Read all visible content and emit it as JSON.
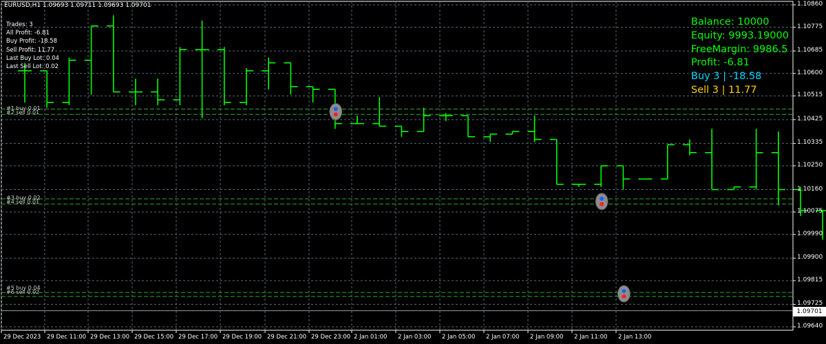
{
  "chart": {
    "symbol_header": "EURUSD,H1  1.09693 1.09711 1.09693 1.09701",
    "last_price": "1.09701"
  },
  "stats": {
    "trades": "Trades: 3",
    "all_profit": "All Profit: -6.81",
    "buy_profit": "Buy Profit: -18.58",
    "sell_profit": "Sell Profit: 11.77",
    "last_buy_lot": "Last Buy Lot: 0.04",
    "last_sell_lot": "Last Sell Lot: 0.02"
  },
  "account": {
    "balance": "Balance: 10000",
    "equity": "Equity: 9993.19000",
    "free_margin": "FreeMargin: 9986.5",
    "profit": "Profit: -6.81",
    "buy": "Buy 3 | -18.58",
    "sell": "Sell 3 | 11.77"
  },
  "order_labels": [
    {
      "buy": "#1 buy 0.01",
      "sell": "#2 sell 0.01"
    },
    {
      "buy": "#3 buy 0.02",
      "sell": "#4 sell 0.01"
    },
    {
      "buy": "#5 buy 0.04",
      "sell": "#6 sell 0.02"
    }
  ],
  "price_axis": [
    "1.10860",
    "1.10775",
    "1.10685",
    "1.10600",
    "1.10515",
    "1.10425",
    "1.10335",
    "1.10250",
    "1.10160",
    "1.10075",
    "1.09990",
    "1.09900",
    "1.09815",
    "1.09725",
    "1.09640"
  ],
  "time_axis": [
    "29 Dec 2023",
    "29 Dec 11:00",
    "29 Dec 13:00",
    "29 Dec 15:00",
    "29 Dec 17:00",
    "29 Dec 19:00",
    "29 Dec 21:00",
    "29 Dec 23:00",
    "2 Jan 01:00",
    "2 Jan 03:00",
    "2 Jan 05:00",
    "2 Jan 07:00",
    "2 Jan 09:00",
    "2 Jan 11:00",
    "2 Jan 13:00"
  ],
  "colors": {
    "bars": "#00ff00",
    "grid": "#5a6b7a",
    "order_line": "#2fa82f",
    "equity_text": "#00ff00",
    "buy_text": "#00d8ff",
    "sell_text": "#ffd000"
  },
  "chart_data": {
    "type": "ohlc",
    "ylim": [
      1.096,
      1.109
    ],
    "bars": [
      {
        "o": 1.1061,
        "h": 1.1064,
        "l": 1.1049,
        "c": 1.1061
      },
      {
        "o": 1.1061,
        "h": 1.1061,
        "l": 1.1047,
        "c": 1.1049
      },
      {
        "o": 1.1049,
        "h": 1.1066,
        "l": 1.1048,
        "c": 1.1065
      },
      {
        "o": 1.1065,
        "h": 1.1078,
        "l": 1.1052,
        "c": 1.1078
      },
      {
        "o": 1.1078,
        "h": 1.1082,
        "l": 1.1053,
        "c": 1.1053
      },
      {
        "o": 1.1053,
        "h": 1.1058,
        "l": 1.1048,
        "c": 1.1053
      },
      {
        "o": 1.1053,
        "h": 1.1058,
        "l": 1.1048,
        "c": 1.105
      },
      {
        "o": 1.105,
        "h": 1.107,
        "l": 1.1048,
        "c": 1.1069
      },
      {
        "o": 1.1069,
        "h": 1.108,
        "l": 1.1043,
        "c": 1.1069
      },
      {
        "o": 1.1069,
        "h": 1.107,
        "l": 1.1048,
        "c": 1.1049
      },
      {
        "o": 1.1049,
        "h": 1.1062,
        "l": 1.1048,
        "c": 1.1061
      },
      {
        "o": 1.1061,
        "h": 1.1066,
        "l": 1.1054,
        "c": 1.1064
      },
      {
        "o": 1.1064,
        "h": 1.1064,
        "l": 1.1052,
        "c": 1.1055
      },
      {
        "o": 1.1055,
        "h": 1.1055,
        "l": 1.1049,
        "c": 1.1054
      },
      {
        "o": 1.1054,
        "h": 1.1054,
        "l": 1.1039,
        "c": 1.1041
      },
      {
        "o": 1.1041,
        "h": 1.1044,
        "l": 1.1041,
        "c": 1.1041
      },
      {
        "o": 1.1041,
        "h": 1.1051,
        "l": 1.104,
        "c": 1.104
      },
      {
        "o": 1.104,
        "h": 1.104,
        "l": 1.1036,
        "c": 1.1038
      },
      {
        "o": 1.1038,
        "h": 1.1047,
        "l": 1.1038,
        "c": 1.1044
      },
      {
        "o": 1.1044,
        "h": 1.1045,
        "l": 1.1042,
        "c": 1.1044
      },
      {
        "o": 1.1044,
        "h": 1.1044,
        "l": 1.1036,
        "c": 1.1036
      },
      {
        "o": 1.1036,
        "h": 1.1037,
        "l": 1.1034,
        "c": 1.1037
      },
      {
        "o": 1.1037,
        "h": 1.1038,
        "l": 1.1037,
        "c": 1.1038
      },
      {
        "o": 1.1038,
        "h": 1.1044,
        "l": 1.1034,
        "c": 1.1035
      },
      {
        "o": 1.1035,
        "h": 1.1035,
        "l": 1.1018,
        "c": 1.1018
      },
      {
        "o": 1.1018,
        "h": 1.1018,
        "l": 1.1017,
        "c": 1.1018
      },
      {
        "o": 1.1018,
        "h": 1.1025,
        "l": 1.1017,
        "c": 1.1025
      },
      {
        "o": 1.1025,
        "h": 1.1025,
        "l": 1.1016,
        "c": 1.102
      },
      {
        "o": 1.102,
        "h": 1.102,
        "l": 1.102,
        "c": 1.102
      },
      {
        "o": 1.102,
        "h": 1.1033,
        "l": 1.102,
        "c": 1.1033
      },
      {
        "o": 1.1033,
        "h": 1.1035,
        "l": 1.1029,
        "c": 1.103
      },
      {
        "o": 1.103,
        "h": 1.1039,
        "l": 1.1016,
        "c": 1.1016
      },
      {
        "o": 1.1016,
        "h": 1.1017,
        "l": 1.1016,
        "c": 1.1017
      },
      {
        "o": 1.1017,
        "h": 1.1039,
        "l": 1.1016,
        "c": 1.103
      },
      {
        "o": 1.103,
        "h": 1.1038,
        "l": 1.101,
        "c": 1.1016
      },
      {
        "o": 1.1016,
        "h": 1.1017,
        "l": 1.1006,
        "c": 1.1008
      },
      {
        "o": 1.1008,
        "h": 1.1008,
        "l": 1.0997,
        "c": 1.1008
      },
      {
        "o": 1.1008,
        "h": 1.1008,
        "l": 1.0974,
        "c": 1.0977
      },
      {
        "o": 1.0977,
        "h": 1.0977,
        "l": 1.0969,
        "c": 1.097
      },
      {
        "o": 1.097,
        "h": 1.09711,
        "l": 1.09693,
        "c": 1.09701
      }
    ],
    "order_levels": [
      {
        "buy": 1.10465,
        "sell": 1.10445
      },
      {
        "buy": 1.10125,
        "sell": 1.10105
      },
      {
        "buy": 1.0977,
        "sell": 1.09755
      }
    ],
    "trade_markers": [
      {
        "bar": 14,
        "price": 1.10455
      },
      {
        "bar": 26,
        "price": 1.10115
      },
      {
        "bar": 27,
        "price": 1.09765
      }
    ]
  }
}
